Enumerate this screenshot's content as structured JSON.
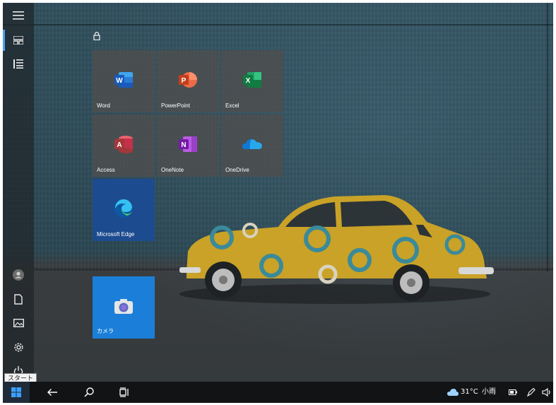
{
  "start_menu": {
    "tooltip": "スタート",
    "rail": {
      "top": [
        "hamburger-icon",
        "tiles-icon",
        "list-icon"
      ],
      "bottom": [
        "user-icon",
        "document-icon",
        "pictures-icon",
        "settings-icon",
        "power-icon"
      ]
    },
    "tiles": [
      {
        "label": "Word",
        "icon": "word-icon"
      },
      {
        "label": "PowerPoint",
        "icon": "powerpoint-icon"
      },
      {
        "label": "Excel",
        "icon": "excel-icon"
      },
      {
        "label": "Access",
        "icon": "access-icon"
      },
      {
        "label": "OneNote",
        "icon": "onenote-icon"
      },
      {
        "label": "OneDrive",
        "icon": "onedrive-icon"
      },
      {
        "label": "Microsoft Edge",
        "icon": "edge-icon"
      },
      {
        "label": "カメラ",
        "icon": "camera-icon"
      }
    ]
  },
  "taskbar": {
    "weather": {
      "temp": "31°C",
      "condition": "小雨"
    },
    "icons": [
      "start-icon",
      "back-icon",
      "search-icon",
      "task-view-icon",
      "battery-icon",
      "pen-icon",
      "volume-icon"
    ]
  },
  "colors": {
    "accent": "#1b7fd9",
    "edge_tile": "#1d4b8f",
    "taskbar": "#111315"
  }
}
